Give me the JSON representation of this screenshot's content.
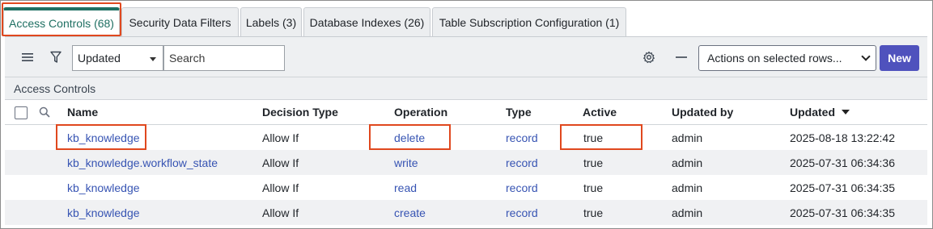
{
  "tabs": [
    {
      "label": "Access Controls (68)"
    },
    {
      "label": "Security Data Filters"
    },
    {
      "label": "Labels (3)"
    },
    {
      "label": "Database Indexes (26)"
    },
    {
      "label": "Table Subscription Configuration (1)"
    }
  ],
  "toolbar": {
    "menu_icon": "hamburger-menu-icon",
    "filter_icon": "filter-icon",
    "search_field_select": "Updated",
    "search_placeholder": "Search",
    "settings_icon": "gear-icon",
    "collapse_icon": "minus-icon",
    "actions_select": "Actions on selected rows...",
    "new_label": "New"
  },
  "section": {
    "label": "Access Controls"
  },
  "table": {
    "columns": [
      "Name",
      "Decision Type",
      "Operation",
      "Type",
      "Active",
      "Updated by",
      "Updated"
    ],
    "sort_indicator": "descending",
    "rows": [
      {
        "name": "kb_knowledge",
        "decision": "Allow If",
        "operation": "delete",
        "type": "record",
        "active": "true",
        "updated_by": "admin",
        "updated": "2025-08-18 13:22:42"
      },
      {
        "name": "kb_knowledge.workflow_state",
        "decision": "Allow If",
        "operation": "write",
        "type": "record",
        "active": "true",
        "updated_by": "admin",
        "updated": "2025-07-31 06:34:36"
      },
      {
        "name": "kb_knowledge",
        "decision": "Allow If",
        "operation": "read",
        "type": "record",
        "active": "true",
        "updated_by": "admin",
        "updated": "2025-07-31 06:34:35"
      },
      {
        "name": "kb_knowledge",
        "decision": "Allow If",
        "operation": "create",
        "type": "record",
        "active": "true",
        "updated_by": "admin",
        "updated": "2025-07-31 06:34:35"
      }
    ]
  },
  "colors": {
    "accent_tab": "#1e6f62",
    "new_button": "#4f52bd",
    "link": "#3754b3",
    "highlight": "#e0481e"
  }
}
